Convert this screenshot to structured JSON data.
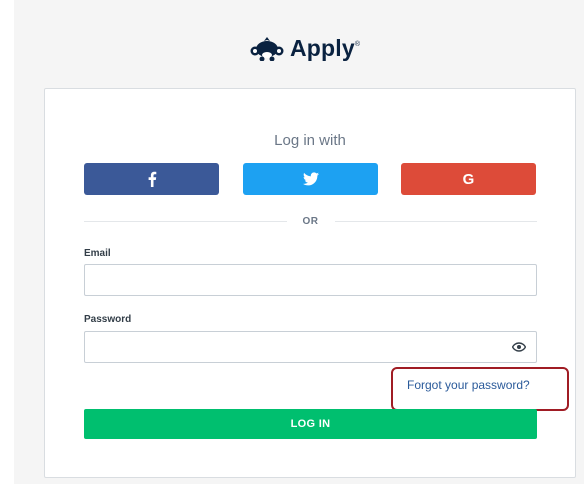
{
  "brand": {
    "name": "Apply",
    "mark": "®"
  },
  "login": {
    "heading": "Log in with",
    "social": [
      {
        "id": "facebook",
        "icon": "facebook-icon",
        "glyph": "f",
        "color": "#3b5998"
      },
      {
        "id": "twitter",
        "icon": "twitter-icon",
        "color": "#1da1f2"
      },
      {
        "id": "google",
        "icon": "google-icon",
        "glyph": "G",
        "color": "#dd4b39"
      }
    ],
    "divider_text": "OR",
    "email_label": "Email",
    "email_value": "",
    "password_label": "Password",
    "password_value": "",
    "password_toggle_icon": "eye-icon",
    "forgot_link": "Forgot your password?",
    "submit_label": "LOG IN",
    "submit_color": "#00bf6f"
  }
}
